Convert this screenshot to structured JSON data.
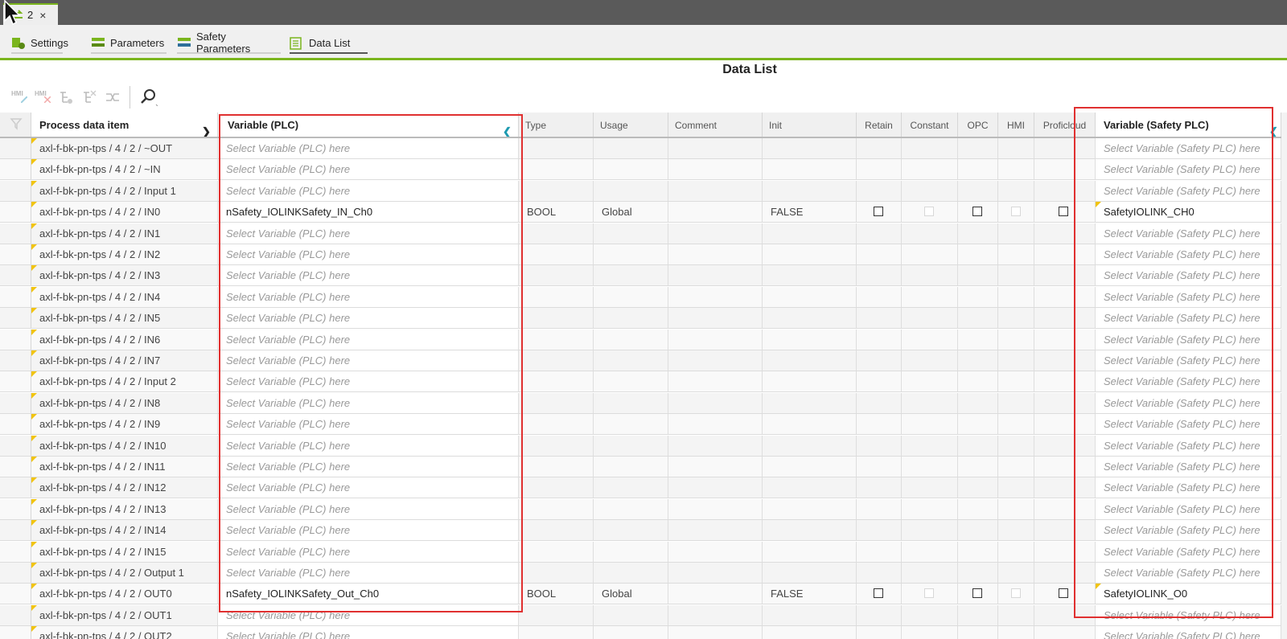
{
  "top_tab": {
    "label": "2",
    "close": "×"
  },
  "subtabs": [
    {
      "label": "Settings"
    },
    {
      "label": "Parameters"
    },
    {
      "label": "Safety Parameters"
    },
    {
      "label": "Data List"
    }
  ],
  "page_title": "Data List",
  "toolbar": {
    "buttons": [
      "HMI",
      "HMI",
      "",
      "",
      ""
    ]
  },
  "columns": {
    "process": "Process data item",
    "variable": "Variable (PLC)",
    "type": "Type",
    "usage": "Usage",
    "comment": "Comment",
    "init": "Init",
    "retain": "Retain",
    "constant": "Constant",
    "opc": "OPC",
    "hmi": "HMI",
    "proficloud": "Proficloud",
    "safety_variable": "Variable (Safety PLC)"
  },
  "placeholders": {
    "variable": "Select Variable (PLC) here",
    "safety_variable": "Select Variable (Safety PLC) here"
  },
  "rows": [
    {
      "process": "axl-f-bk-pn-tps / 4 / 2 / ~OUT"
    },
    {
      "process": "axl-f-bk-pn-tps / 4 / 2 / ~IN"
    },
    {
      "process": "axl-f-bk-pn-tps / 4 / 2 / Input 1"
    },
    {
      "process": "axl-f-bk-pn-tps / 4 / 2 / IN0",
      "variable": "nSafety_IOLINKSafety_IN_Ch0",
      "type": "BOOL",
      "usage": "Global",
      "init": "FALSE",
      "safety_variable": "SafetyIOLINK_CH0"
    },
    {
      "process": "axl-f-bk-pn-tps / 4 / 2 / IN1"
    },
    {
      "process": "axl-f-bk-pn-tps / 4 / 2 / IN2"
    },
    {
      "process": "axl-f-bk-pn-tps / 4 / 2 / IN3"
    },
    {
      "process": "axl-f-bk-pn-tps / 4 / 2 / IN4"
    },
    {
      "process": "axl-f-bk-pn-tps / 4 / 2 / IN5"
    },
    {
      "process": "axl-f-bk-pn-tps / 4 / 2 / IN6"
    },
    {
      "process": "axl-f-bk-pn-tps / 4 / 2 / IN7"
    },
    {
      "process": "axl-f-bk-pn-tps / 4 / 2 / Input 2"
    },
    {
      "process": "axl-f-bk-pn-tps / 4 / 2 / IN8"
    },
    {
      "process": "axl-f-bk-pn-tps / 4 / 2 / IN9"
    },
    {
      "process": "axl-f-bk-pn-tps / 4 / 2 / IN10"
    },
    {
      "process": "axl-f-bk-pn-tps / 4 / 2 / IN11"
    },
    {
      "process": "axl-f-bk-pn-tps / 4 / 2 / IN12"
    },
    {
      "process": "axl-f-bk-pn-tps / 4 / 2 / IN13"
    },
    {
      "process": "axl-f-bk-pn-tps / 4 / 2 / IN14"
    },
    {
      "process": "axl-f-bk-pn-tps / 4 / 2 / IN15"
    },
    {
      "process": "axl-f-bk-pn-tps / 4 / 2 / Output 1"
    },
    {
      "process": "axl-f-bk-pn-tps / 4 / 2 / OUT0",
      "variable": "nSafety_IOLINKSafety_Out_Ch0",
      "type": "BOOL",
      "usage": "Global",
      "init": "FALSE",
      "safety_variable": "SafetyIOLINK_O0"
    },
    {
      "process": "axl-f-bk-pn-tps / 4 / 2 / OUT1"
    },
    {
      "process": "axl-f-bk-pn-tps / 4 / 2 / OUT2"
    }
  ],
  "colors": {
    "accent": "#7ab51d",
    "highlight": "#e03030",
    "marker": "#f1c40f"
  }
}
